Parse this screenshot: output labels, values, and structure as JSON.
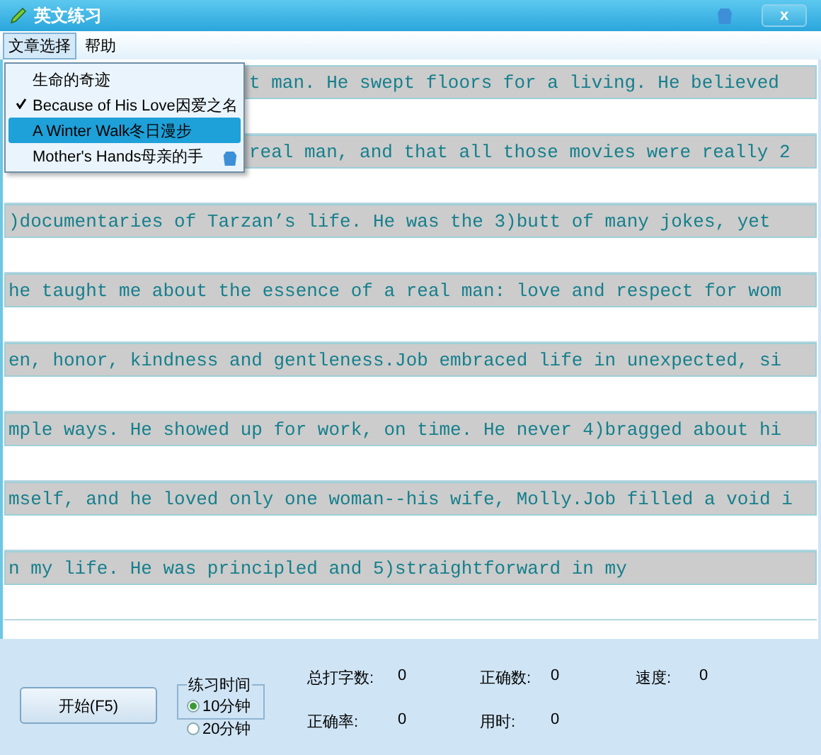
{
  "window": {
    "title": "英文练习",
    "close": "x"
  },
  "menu": [
    {
      "label": "文章选择",
      "selected": true
    },
    {
      "label": "帮助",
      "selected": false
    }
  ],
  "dropdown": [
    {
      "label": "生命的奇迹",
      "checked": false,
      "selected": false
    },
    {
      "label": "Because of His Love因爱之名",
      "checked": true,
      "selected": false
    },
    {
      "label": "A Winter Walk冬日漫步",
      "checked": false,
      "selected": true
    },
    {
      "label": "Mother's Hands母亲的手",
      "checked": false,
      "selected": false
    }
  ],
  "passage": [
    {
      "text": "t man. He swept floors for a living. He believed",
      "covered": true
    },
    {
      "text": "real man, and that all those movies were really 2",
      "covered": true
    },
    {
      "text": ")documentaries of Tarzan’s life. He was the 3)butt of many jokes, yet",
      "covered": false
    },
    {
      "text": "he taught me about the essence of a real man: love and respect for wom",
      "covered": false
    },
    {
      "text": "en, honor, kindness and gentleness.Job embraced life in unexpected, si",
      "covered": false
    },
    {
      "text": "mple ways. He showed up for work, on time. He never 4)bragged about hi",
      "covered": false
    },
    {
      "text": "mself, and he loved only one woman--his wife, Molly.Job filled a void i",
      "covered": false
    },
    {
      "text": "n my life. He was principled and 5)straightforward in my",
      "covered": false
    }
  ],
  "start_button": "开始(F5)",
  "practice_time": {
    "title": "练习时间",
    "options": [
      {
        "label": "10分钟",
        "selected": true
      },
      {
        "label": "20分钟",
        "selected": false
      }
    ]
  },
  "stats": [
    {
      "label": "总打字数:",
      "value": "0"
    },
    {
      "label": "正确数:",
      "value": "0"
    },
    {
      "label": "速度:",
      "value": "0"
    },
    {
      "label": "正确率:",
      "value": "0"
    },
    {
      "label": "用时:",
      "value": "0"
    }
  ]
}
